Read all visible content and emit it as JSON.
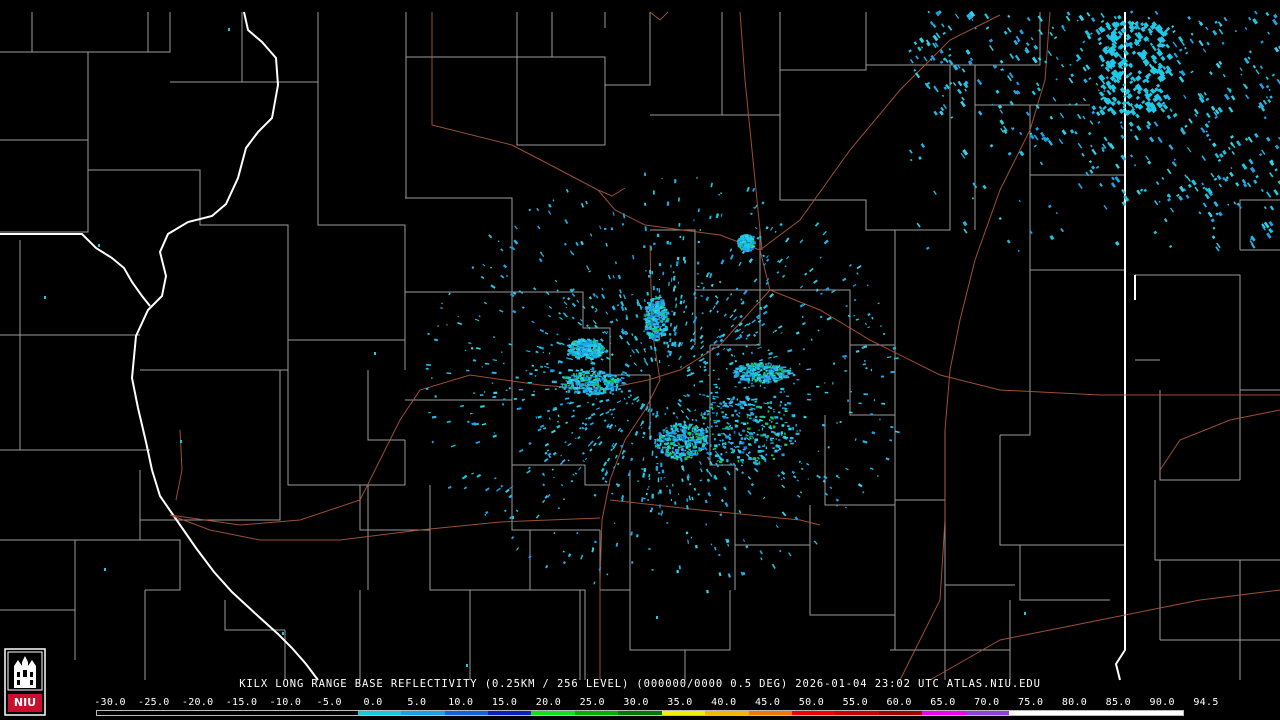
{
  "map": {
    "caption": "KILX LONG RANGE BASE REFLECTIVITY (0.25KM / 256 LEVEL) (000000/0000 0.5 DEG) 2026-01-04 23:02 UTC  ATLAS.NIU.EDU",
    "colors": {
      "background": "#000000",
      "county_lines": "#9a9a9a",
      "state_lines": "#ffffff",
      "highways": "#b0583a"
    }
  },
  "color_scale": {
    "labels": [
      "-30.0",
      "-25.0",
      "-20.0",
      "-15.0",
      "-10.0",
      "-5.0",
      "0.0",
      "5.0",
      "10.0",
      "15.0",
      "20.0",
      "25.0",
      "30.0",
      "35.0",
      "40.0",
      "45.0",
      "50.0",
      "55.0",
      "60.0",
      "65.0",
      "70.0",
      "75.0",
      "80.0",
      "85.0",
      "90.0",
      "94.5"
    ],
    "colors": [
      "#000000",
      "#000000",
      "#000000",
      "#000000",
      "#000000",
      "#000000",
      "#18c8d8",
      "#1aa0e8",
      "#1860e0",
      "#0a20c0",
      "#10e020",
      "#00b000",
      "#007800",
      "#f0f000",
      "#f0b800",
      "#f07800",
      "#f00000",
      "#c80000",
      "#a00000",
      "#f000f0",
      "#9040e0",
      "#ffffff",
      "#ffffff",
      "#ffffff",
      "#ffffff"
    ]
  },
  "logo": {
    "text": "NIU",
    "colors": {
      "box": "#c8102e",
      "border": "#ffffff"
    }
  }
}
